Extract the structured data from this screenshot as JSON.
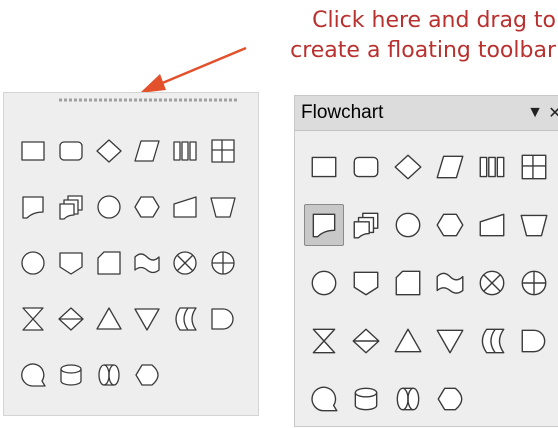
{
  "callout": {
    "line1": "Click here and drag to",
    "line2": "create a floating toolbar"
  },
  "colors": {
    "callout": "#b8312f",
    "arrow": "#e2502c",
    "panel": "#eeeeee"
  },
  "floating_toolbar": {
    "title": "Flowchart",
    "menu_icon": "dropdown-triangle-icon",
    "close_icon": "close-icon"
  },
  "shapes": [
    [
      "process",
      "alternate-process",
      "decision",
      "data",
      "predefined-process",
      "internal-storage"
    ],
    [
      "document",
      "multidocument",
      "terminator",
      "preparation",
      "manual-input",
      "manual-operation"
    ],
    [
      "connector",
      "off-page-connector",
      "card",
      "punched-tape",
      "summing-junction",
      "or"
    ],
    [
      "collate",
      "sort",
      "extract",
      "merge",
      "stored-data",
      "delay"
    ],
    [
      "sequential-access",
      "magnetic-disk",
      "direct-access-storage",
      "display"
    ]
  ],
  "selected_shape": "document"
}
